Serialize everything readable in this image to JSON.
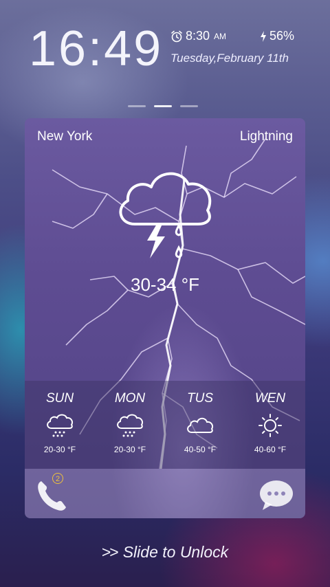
{
  "clock": {
    "time": "16:49"
  },
  "status": {
    "alarm_time": "8:30",
    "alarm_suffix": "AM",
    "battery": "56%",
    "date": "Tuesday,February 11th"
  },
  "weather": {
    "city": "New York",
    "condition": "Lightning",
    "temperature": "30-34 °F",
    "icon": "thunderstorm-rain-icon",
    "forecast": [
      {
        "day": "SUN",
        "range": "20-30 °F",
        "icon": "rain-cloud-icon"
      },
      {
        "day": "MON",
        "range": "20-30 °F",
        "icon": "rain-cloud-icon"
      },
      {
        "day": "TUS",
        "range": "40-50 °F",
        "icon": "cloud-icon"
      },
      {
        "day": "WEN",
        "range": "40-60 °F",
        "icon": "sun-icon"
      }
    ]
  },
  "dock": {
    "missed_calls": "2",
    "left_icon": "phone-icon",
    "right_icon": "message-icon"
  },
  "unlock": {
    "arrows": ">>",
    "label": "Slide to Unlock"
  },
  "colors": {
    "badge": "#f0c23a",
    "card": "#5e4c92"
  }
}
